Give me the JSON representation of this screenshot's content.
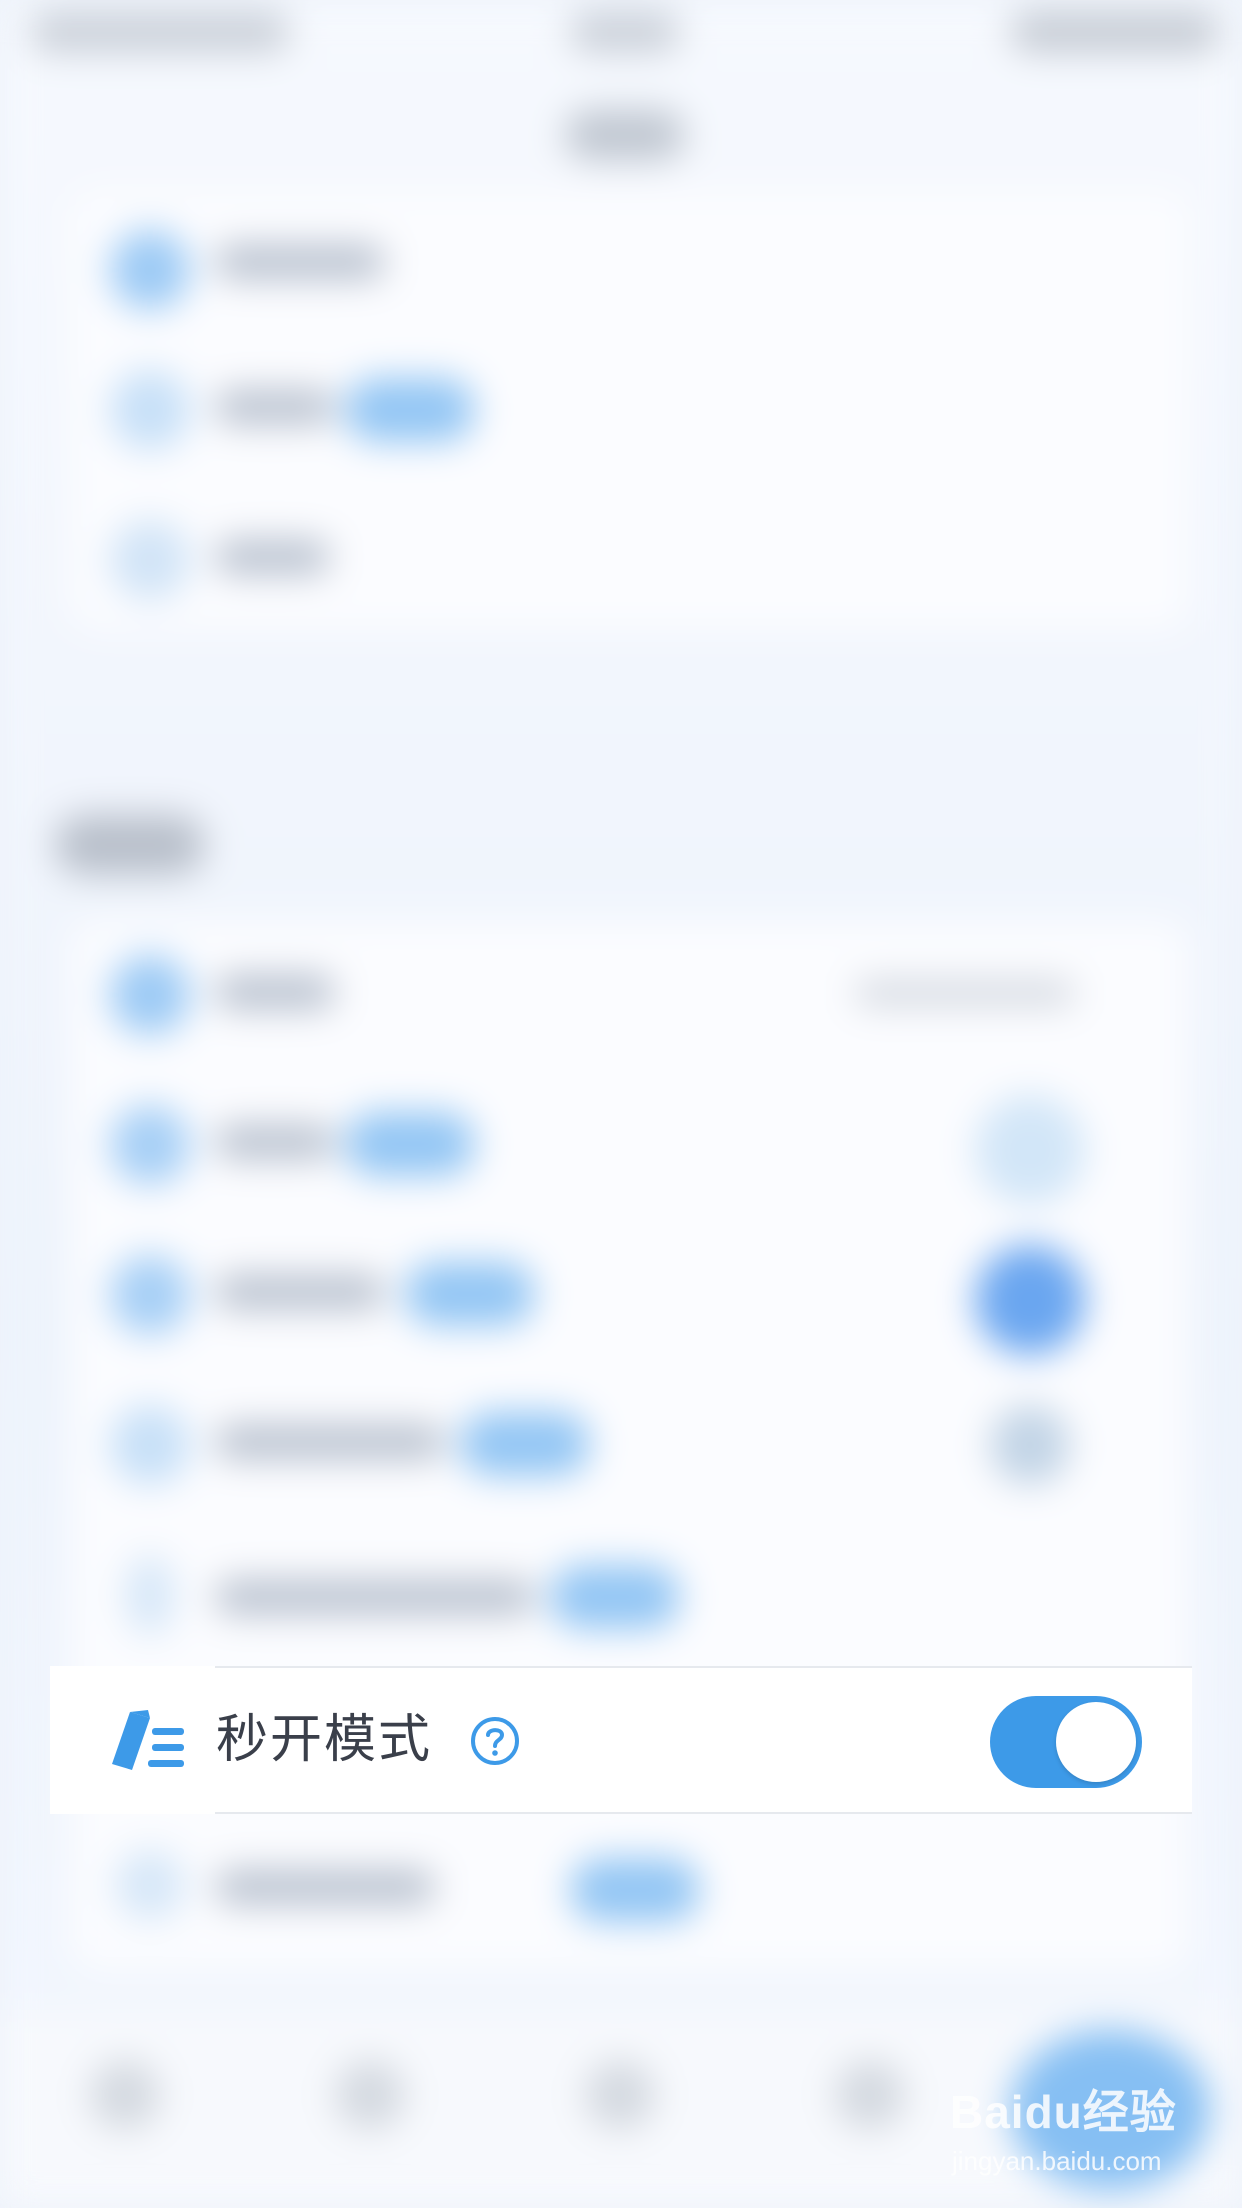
{
  "setting_row": {
    "label": "秒开模式",
    "toggle_on": true,
    "icon": "edit-list-icon",
    "help_icon": "question-mark-circle-icon"
  },
  "colors": {
    "accent": "#3d9ae8",
    "label": "#3a3f4a",
    "background": "#eef3fb"
  },
  "watermark": {
    "brand": "Baidu经验",
    "url": "jingyan.baidu.com"
  }
}
